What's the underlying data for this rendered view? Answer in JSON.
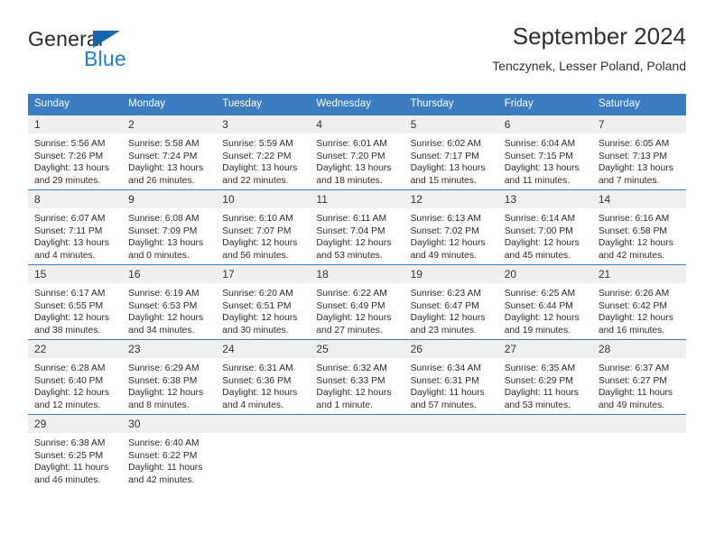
{
  "brand": {
    "name_top": "General",
    "name_bottom": "Blue",
    "triangle_color": "#1565b0",
    "blue_text_color": "#1b7fd4"
  },
  "header": {
    "title": "September 2024",
    "subtitle": "Tenczynek, Lesser Poland, Poland",
    "header_bg": "#3b7dc0",
    "header_text_color": "#ffffff",
    "daynum_bg": "#f0f0f0"
  },
  "weekdays": [
    "Sunday",
    "Monday",
    "Tuesday",
    "Wednesday",
    "Thursday",
    "Friday",
    "Saturday"
  ],
  "weeks": [
    [
      {
        "day": "1",
        "sunrise": "Sunrise: 5:56 AM",
        "sunset": "Sunset: 7:26 PM",
        "daylight_l1": "Daylight: 13 hours",
        "daylight_l2": "and 29 minutes."
      },
      {
        "day": "2",
        "sunrise": "Sunrise: 5:58 AM",
        "sunset": "Sunset: 7:24 PM",
        "daylight_l1": "Daylight: 13 hours",
        "daylight_l2": "and 26 minutes."
      },
      {
        "day": "3",
        "sunrise": "Sunrise: 5:59 AM",
        "sunset": "Sunset: 7:22 PM",
        "daylight_l1": "Daylight: 13 hours",
        "daylight_l2": "and 22 minutes."
      },
      {
        "day": "4",
        "sunrise": "Sunrise: 6:01 AM",
        "sunset": "Sunset: 7:20 PM",
        "daylight_l1": "Daylight: 13 hours",
        "daylight_l2": "and 18 minutes."
      },
      {
        "day": "5",
        "sunrise": "Sunrise: 6:02 AM",
        "sunset": "Sunset: 7:17 PM",
        "daylight_l1": "Daylight: 13 hours",
        "daylight_l2": "and 15 minutes."
      },
      {
        "day": "6",
        "sunrise": "Sunrise: 6:04 AM",
        "sunset": "Sunset: 7:15 PM",
        "daylight_l1": "Daylight: 13 hours",
        "daylight_l2": "and 11 minutes."
      },
      {
        "day": "7",
        "sunrise": "Sunrise: 6:05 AM",
        "sunset": "Sunset: 7:13 PM",
        "daylight_l1": "Daylight: 13 hours",
        "daylight_l2": "and 7 minutes."
      }
    ],
    [
      {
        "day": "8",
        "sunrise": "Sunrise: 6:07 AM",
        "sunset": "Sunset: 7:11 PM",
        "daylight_l1": "Daylight: 13 hours",
        "daylight_l2": "and 4 minutes."
      },
      {
        "day": "9",
        "sunrise": "Sunrise: 6:08 AM",
        "sunset": "Sunset: 7:09 PM",
        "daylight_l1": "Daylight: 13 hours",
        "daylight_l2": "and 0 minutes."
      },
      {
        "day": "10",
        "sunrise": "Sunrise: 6:10 AM",
        "sunset": "Sunset: 7:07 PM",
        "daylight_l1": "Daylight: 12 hours",
        "daylight_l2": "and 56 minutes."
      },
      {
        "day": "11",
        "sunrise": "Sunrise: 6:11 AM",
        "sunset": "Sunset: 7:04 PM",
        "daylight_l1": "Daylight: 12 hours",
        "daylight_l2": "and 53 minutes."
      },
      {
        "day": "12",
        "sunrise": "Sunrise: 6:13 AM",
        "sunset": "Sunset: 7:02 PM",
        "daylight_l1": "Daylight: 12 hours",
        "daylight_l2": "and 49 minutes."
      },
      {
        "day": "13",
        "sunrise": "Sunrise: 6:14 AM",
        "sunset": "Sunset: 7:00 PM",
        "daylight_l1": "Daylight: 12 hours",
        "daylight_l2": "and 45 minutes."
      },
      {
        "day": "14",
        "sunrise": "Sunrise: 6:16 AM",
        "sunset": "Sunset: 6:58 PM",
        "daylight_l1": "Daylight: 12 hours",
        "daylight_l2": "and 42 minutes."
      }
    ],
    [
      {
        "day": "15",
        "sunrise": "Sunrise: 6:17 AM",
        "sunset": "Sunset: 6:55 PM",
        "daylight_l1": "Daylight: 12 hours",
        "daylight_l2": "and 38 minutes."
      },
      {
        "day": "16",
        "sunrise": "Sunrise: 6:19 AM",
        "sunset": "Sunset: 6:53 PM",
        "daylight_l1": "Daylight: 12 hours",
        "daylight_l2": "and 34 minutes."
      },
      {
        "day": "17",
        "sunrise": "Sunrise: 6:20 AM",
        "sunset": "Sunset: 6:51 PM",
        "daylight_l1": "Daylight: 12 hours",
        "daylight_l2": "and 30 minutes."
      },
      {
        "day": "18",
        "sunrise": "Sunrise: 6:22 AM",
        "sunset": "Sunset: 6:49 PM",
        "daylight_l1": "Daylight: 12 hours",
        "daylight_l2": "and 27 minutes."
      },
      {
        "day": "19",
        "sunrise": "Sunrise: 6:23 AM",
        "sunset": "Sunset: 6:47 PM",
        "daylight_l1": "Daylight: 12 hours",
        "daylight_l2": "and 23 minutes."
      },
      {
        "day": "20",
        "sunrise": "Sunrise: 6:25 AM",
        "sunset": "Sunset: 6:44 PM",
        "daylight_l1": "Daylight: 12 hours",
        "daylight_l2": "and 19 minutes."
      },
      {
        "day": "21",
        "sunrise": "Sunrise: 6:26 AM",
        "sunset": "Sunset: 6:42 PM",
        "daylight_l1": "Daylight: 12 hours",
        "daylight_l2": "and 16 minutes."
      }
    ],
    [
      {
        "day": "22",
        "sunrise": "Sunrise: 6:28 AM",
        "sunset": "Sunset: 6:40 PM",
        "daylight_l1": "Daylight: 12 hours",
        "daylight_l2": "and 12 minutes."
      },
      {
        "day": "23",
        "sunrise": "Sunrise: 6:29 AM",
        "sunset": "Sunset: 6:38 PM",
        "daylight_l1": "Daylight: 12 hours",
        "daylight_l2": "and 8 minutes."
      },
      {
        "day": "24",
        "sunrise": "Sunrise: 6:31 AM",
        "sunset": "Sunset: 6:36 PM",
        "daylight_l1": "Daylight: 12 hours",
        "daylight_l2": "and 4 minutes."
      },
      {
        "day": "25",
        "sunrise": "Sunrise: 6:32 AM",
        "sunset": "Sunset: 6:33 PM",
        "daylight_l1": "Daylight: 12 hours",
        "daylight_l2": "and 1 minute."
      },
      {
        "day": "26",
        "sunrise": "Sunrise: 6:34 AM",
        "sunset": "Sunset: 6:31 PM",
        "daylight_l1": "Daylight: 11 hours",
        "daylight_l2": "and 57 minutes."
      },
      {
        "day": "27",
        "sunrise": "Sunrise: 6:35 AM",
        "sunset": "Sunset: 6:29 PM",
        "daylight_l1": "Daylight: 11 hours",
        "daylight_l2": "and 53 minutes."
      },
      {
        "day": "28",
        "sunrise": "Sunrise: 6:37 AM",
        "sunset": "Sunset: 6:27 PM",
        "daylight_l1": "Daylight: 11 hours",
        "daylight_l2": "and 49 minutes."
      }
    ],
    [
      {
        "day": "29",
        "sunrise": "Sunrise: 6:38 AM",
        "sunset": "Sunset: 6:25 PM",
        "daylight_l1": "Daylight: 11 hours",
        "daylight_l2": "and 46 minutes."
      },
      {
        "day": "30",
        "sunrise": "Sunrise: 6:40 AM",
        "sunset": "Sunset: 6:22 PM",
        "daylight_l1": "Daylight: 11 hours",
        "daylight_l2": "and 42 minutes."
      },
      {
        "day": "",
        "sunrise": "",
        "sunset": "",
        "daylight_l1": "",
        "daylight_l2": ""
      },
      {
        "day": "",
        "sunrise": "",
        "sunset": "",
        "daylight_l1": "",
        "daylight_l2": ""
      },
      {
        "day": "",
        "sunrise": "",
        "sunset": "",
        "daylight_l1": "",
        "daylight_l2": ""
      },
      {
        "day": "",
        "sunrise": "",
        "sunset": "",
        "daylight_l1": "",
        "daylight_l2": ""
      },
      {
        "day": "",
        "sunrise": "",
        "sunset": "",
        "daylight_l1": "",
        "daylight_l2": ""
      }
    ]
  ]
}
